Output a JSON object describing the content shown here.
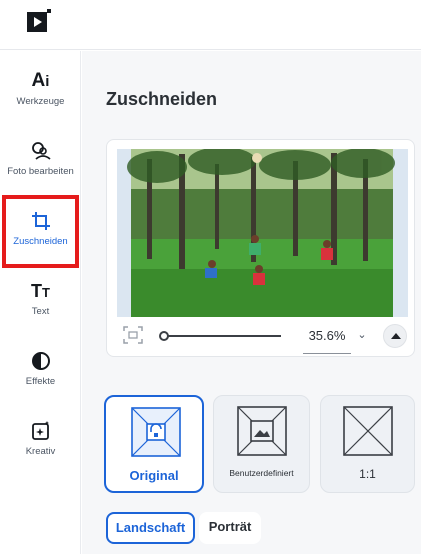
{
  "app": {
    "logo": "play-logo-icon"
  },
  "sidebar": {
    "items": [
      {
        "label": "Werkzeuge",
        "icon": "ai-tools-icon"
      },
      {
        "label": "Foto bearbeiten",
        "icon": "photo-edit-icon"
      },
      {
        "label": "Zuschneiden",
        "icon": "crop-icon"
      },
      {
        "label": "Text",
        "icon": "text-icon"
      },
      {
        "label": "Effekte",
        "icon": "effects-icon"
      },
      {
        "label": "Kreativ",
        "icon": "creative-icon"
      }
    ],
    "active": "Zuschneiden",
    "highlight_color": "#e51b1b"
  },
  "panel": {
    "title": "Zuschneiden",
    "zoom": {
      "value": "35.6%",
      "slider_fraction": 0.0
    },
    "icons": {
      "fit": "fit-screen-icon",
      "dropdown": "chevron-down-icon",
      "collapse": "chevron-up-icon"
    }
  },
  "crop_presets": [
    {
      "label": "Original",
      "icon": "lock-frame-icon",
      "selected": true
    },
    {
      "label": "Benutzerdefiniert",
      "icon": "image-frame-icon",
      "selected": false
    },
    {
      "label": "1:1",
      "icon": "square-frame-icon",
      "selected": false
    }
  ],
  "orientation": [
    {
      "label": "Landschaft",
      "selected": true
    },
    {
      "label": "Porträt",
      "selected": false
    }
  ],
  "colors": {
    "accent": "#1c64d8",
    "panel_bg": "#f6f7f9"
  }
}
